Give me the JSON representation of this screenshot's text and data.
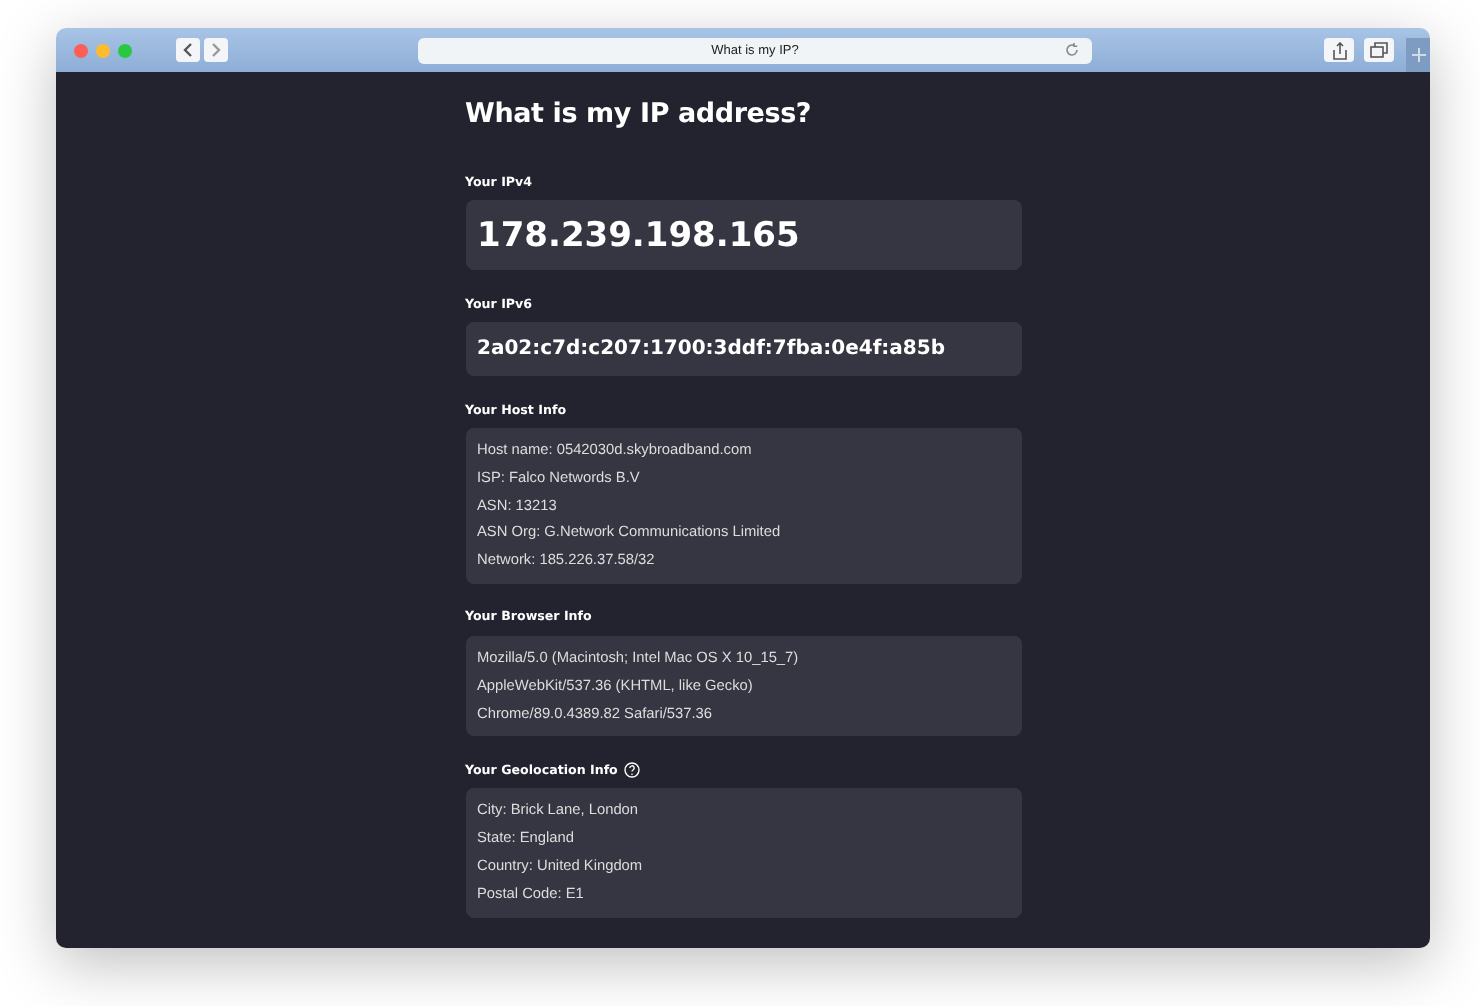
{
  "window": {
    "url_title": "What is my IP?"
  },
  "page": {
    "title": "What is my IP address?",
    "sections": [
      {
        "kind": "ipv4",
        "label": "Your IPv4",
        "lines": [
          "178.239.198.165"
        ],
        "help": false
      },
      {
        "kind": "ipv6",
        "label": "Your IPv6",
        "lines": [
          "2a02:c7d:c207:1700:3ddf:7fba:0e4f:a85b"
        ],
        "help": false
      },
      {
        "kind": "info",
        "label": "Your Host Info",
        "lines": [
          "Host name: 0542030d.skybroadband.com",
          "ISP: Falco Networds B.V",
          "ASN: 13213",
          "ASN Org: G.Network Communications Limited",
          "Network: 185.226.37.58/32"
        ],
        "help": false
      },
      {
        "kind": "info",
        "label": "Your Browser Info",
        "lines": [
          "Mozilla/5.0 (Macintosh; Intel Mac OS X 10_15_7)",
          "AppleWebKit/537.36 (KHTML, like Gecko)",
          "Chrome/89.0.4389.82 Safari/537.36"
        ],
        "help": false
      },
      {
        "kind": "info",
        "label": "Your Geolocation Info",
        "lines": [
          "City: Brick Lane, London",
          "State: England",
          "Country: United Kingdom",
          "Postal Code: E1"
        ],
        "help": true
      }
    ]
  }
}
